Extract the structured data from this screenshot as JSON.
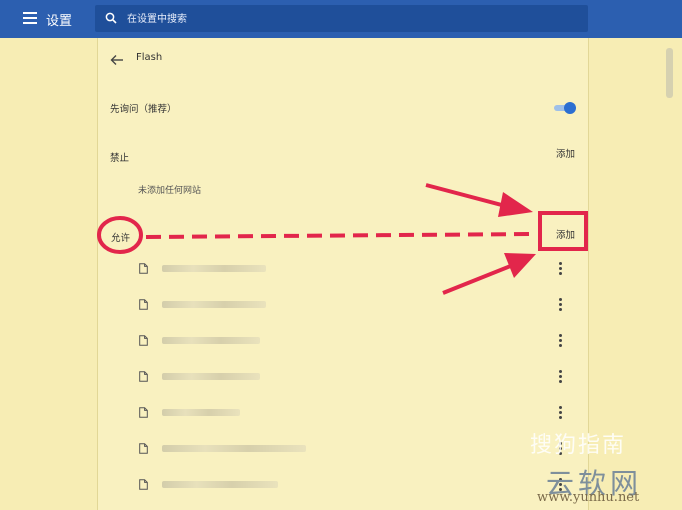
{
  "topbar": {
    "title": "设置",
    "search_placeholder": "在设置中搜索"
  },
  "page": {
    "title": "Flash"
  },
  "settings": {
    "ask_first_label": "先询问（推荐）",
    "ask_first_enabled": true,
    "block": {
      "label": "禁止",
      "add_label": "添加",
      "empty_text": "未添加任何网站"
    },
    "allow": {
      "label": "允许",
      "add_label": "添加",
      "site_count": 7
    }
  },
  "watermark": {
    "line1": "搜狗指南",
    "line2": "云软网",
    "line3": "www.yunhu.net"
  },
  "colors": {
    "topbar": "#2c5fb0",
    "background": "#f7edb4",
    "toggle_on": "#2c6fd1",
    "annotation": "#e2264b"
  }
}
